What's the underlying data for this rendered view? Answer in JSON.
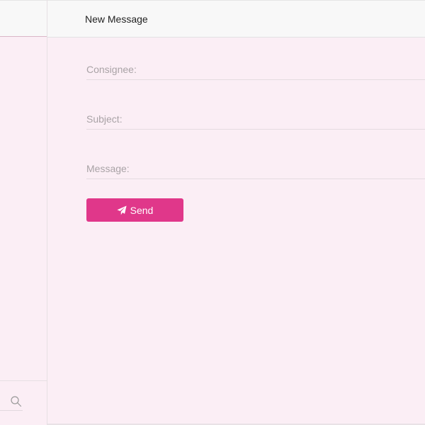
{
  "header": {
    "title": "New Message"
  },
  "form": {
    "consignee_label": "Consignee:",
    "subject_label": "Subject:",
    "message_label": "Message:",
    "send_label": "Send"
  },
  "icons": {
    "send": "paper-plane-icon",
    "search": "search-icon"
  },
  "colors": {
    "accent": "#e0378a",
    "background": "#fbeef5",
    "topbar": "#f8f8f8"
  }
}
